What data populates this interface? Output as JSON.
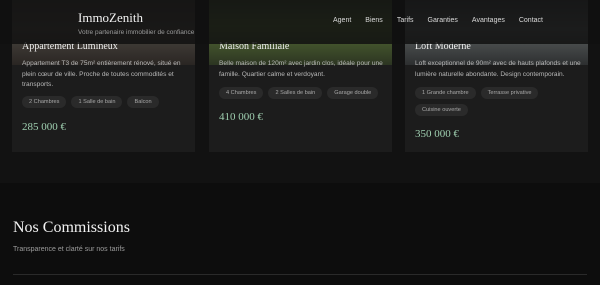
{
  "brand": {
    "name": "ImmoZenith",
    "tagline": "Votre partenaire immobilier de confiance"
  },
  "nav": [
    "Agent",
    "Biens",
    "Tarifs",
    "Garanties",
    "Avantages",
    "Contact"
  ],
  "cards": [
    {
      "title": "Appartement Lumineux",
      "description": "Appartement T3 de 75m² entièrement rénové, situé en plein cœur de ville. Proche de toutes commodités et transports.",
      "tags": [
        "2 Chambres",
        "1 Salle de bain",
        "Balcon"
      ],
      "price": "285 000 €"
    },
    {
      "title": "Maison Familiale",
      "description": "Belle maison de 120m² avec jardin clos, idéale pour une famille. Quartier calme et verdoyant.",
      "tags": [
        "4 Chambres",
        "2 Salles de bain",
        "Garage double"
      ],
      "price": "410 000 €"
    },
    {
      "title": "Loft Moderne",
      "description": "Loft exceptionnel de 90m² avec de hauts plafonds et une lumière naturelle abondante. Design contemporain.",
      "tags": [
        "1 Grande chambre",
        "Terrasse privative",
        "Cuisine ouverte"
      ],
      "price": "350 000 €"
    }
  ],
  "section": {
    "title": "Nos Commissions",
    "subtitle": "Transparence et clarté sur nos tarifs"
  }
}
